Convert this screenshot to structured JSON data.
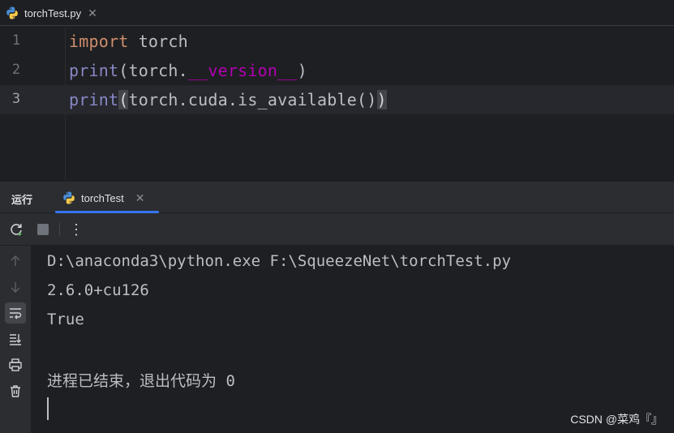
{
  "editor": {
    "tab": {
      "label": "torchTest.py",
      "close": "✕"
    },
    "lines": [
      {
        "number": "1"
      },
      {
        "number": "2"
      },
      {
        "number": "3"
      }
    ],
    "code": {
      "l1_kw": "import",
      "l1_rest": " torch",
      "l2_fn": "print",
      "l2_a": "(torch.",
      "l2_dunder": "__version__",
      "l2_b": ")",
      "l3_fn": "print",
      "l3_open": "(",
      "l3_mid": "torch.cuda.is_available()",
      "l3_close": ")"
    },
    "current_line": 3
  },
  "run": {
    "title": "运行",
    "tab": {
      "label": "torchTest",
      "close": "✕"
    },
    "toolbar": {
      "rerun_icon": "rerun-icon",
      "stop_icon": "stop-icon",
      "more_icon": "more-vertical-icon",
      "more_label": "⋮"
    },
    "side_tools": [
      "arrow-up-icon",
      "arrow-down-icon",
      "soft-wrap-icon",
      "scroll-to-end-icon",
      "print-icon",
      "trash-icon"
    ]
  },
  "console": {
    "lines": [
      "D:\\anaconda3\\python.exe F:\\SqueezeNet\\torchTest.py",
      "2.6.0+cu126",
      "True",
      "",
      "进程已结束，退出代码为 0"
    ]
  },
  "watermark": "CSDN @菜鸡『』",
  "colors": {
    "background": "#1e1f22",
    "panel": "#2b2d30",
    "keyword": "#cf8e6d",
    "builtin": "#8888c6",
    "dunder": "#b200b2",
    "accent": "#3574f0"
  }
}
